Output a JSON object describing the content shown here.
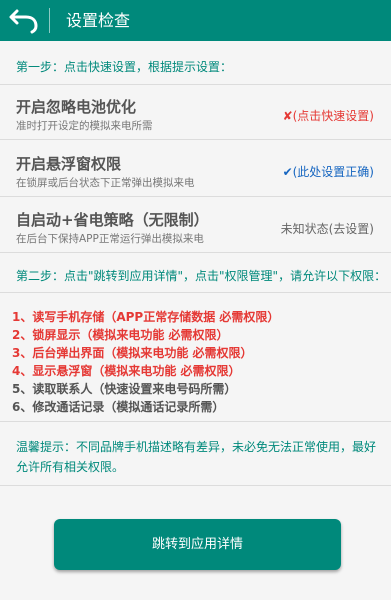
{
  "header": {
    "title": "设置检查",
    "back_icon": "back-arrow-icon"
  },
  "step1": {
    "label": "第一步：点击快速设置，根据提示设置："
  },
  "settings": [
    {
      "title": "开启忽略电池优化",
      "desc": "准时打开设定的模拟来电所需",
      "status_icon": "✘",
      "status": "(点击快速设置)",
      "status_color": "#e53935"
    },
    {
      "title": "开启悬浮窗权限",
      "desc": "在锁屏或后台状态下正常弹出模拟来电",
      "status_icon": "✔",
      "status": "(此处设置正确)",
      "status_color": "#1565c0"
    },
    {
      "title": "自启动+省电策略（无限制）",
      "desc": "在后台下保持APP正常运行弹出模拟来电",
      "status_icon": "",
      "status": "未知状态(去设置)",
      "status_color": "#666666"
    }
  ],
  "step2": {
    "label": "第二步：点击\"跳转到应用详情\"，点击\"权限管理\"，请允许以下权限："
  },
  "permissions": [
    "1、读写手机存储（APP正常存储数据 必需权限）",
    "2、锁屏显示（模拟来电功能 必需权限）",
    "3、后台弹出界面（模拟来电功能 必需权限）",
    "4、显示悬浮窗（模拟来电功能 必需权限）",
    "5、读取联系人（快速设置来电号码所需）",
    "6、修改通话记录（模拟通话记录所需）"
  ],
  "tip": "温馨提示：不同品牌手机描述略有差异，未必免无法正常使用，最好允许所有相关权限。",
  "button": {
    "label": "跳转到应用详情"
  },
  "colors": {
    "primary": "#00897b",
    "required": "#e53935",
    "ok": "#1565c0"
  }
}
